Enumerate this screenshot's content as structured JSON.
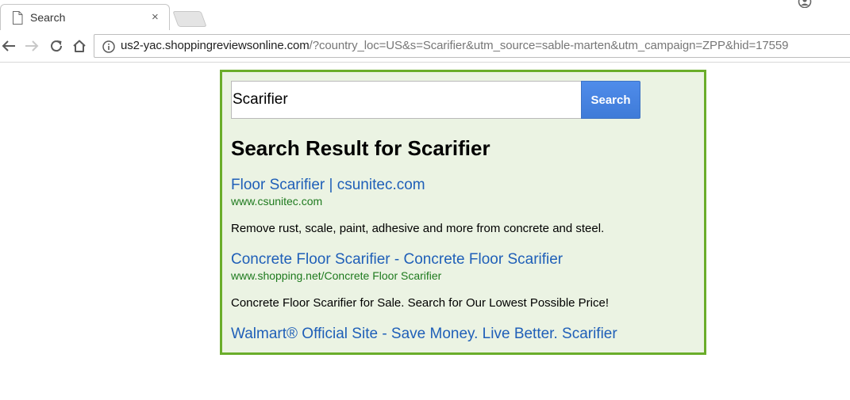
{
  "browser": {
    "tab": {
      "title": "Search",
      "close_glyph": "×"
    },
    "url": {
      "host": "us2-yac.shoppingreviewsonline.com",
      "rest": "/?country_loc=US&s=Scarifier&utm_source=sable-marten&utm_campaign=ZPP&hid=17559"
    }
  },
  "search": {
    "value": "Scarifier",
    "button_label": "Search"
  },
  "heading": "Search Result for Scarifier",
  "results": [
    {
      "title": "Floor Scarifier | csunitec.com",
      "url": "www.csunitec.com",
      "description": "Remove rust, scale, paint, adhesive and more from concrete and steel."
    },
    {
      "title": "Concrete Floor Scarifier - Concrete Floor Scarifier",
      "url": "www.shopping.net/Concrete Floor Scarifier",
      "description": "Concrete Floor Scarifier for Sale. Search for Our Lowest Possible Price!"
    },
    {
      "title": "Walmart® Official Site - Save Money. Live Better. Scarifier",
      "url": "",
      "description": ""
    }
  ],
  "colors": {
    "panel_border": "#6aad2a",
    "panel_background": "#ebf3e3",
    "link": "#1f5fb8",
    "display_url": "#1e7a1e",
    "search_button": "#4a86e0"
  }
}
